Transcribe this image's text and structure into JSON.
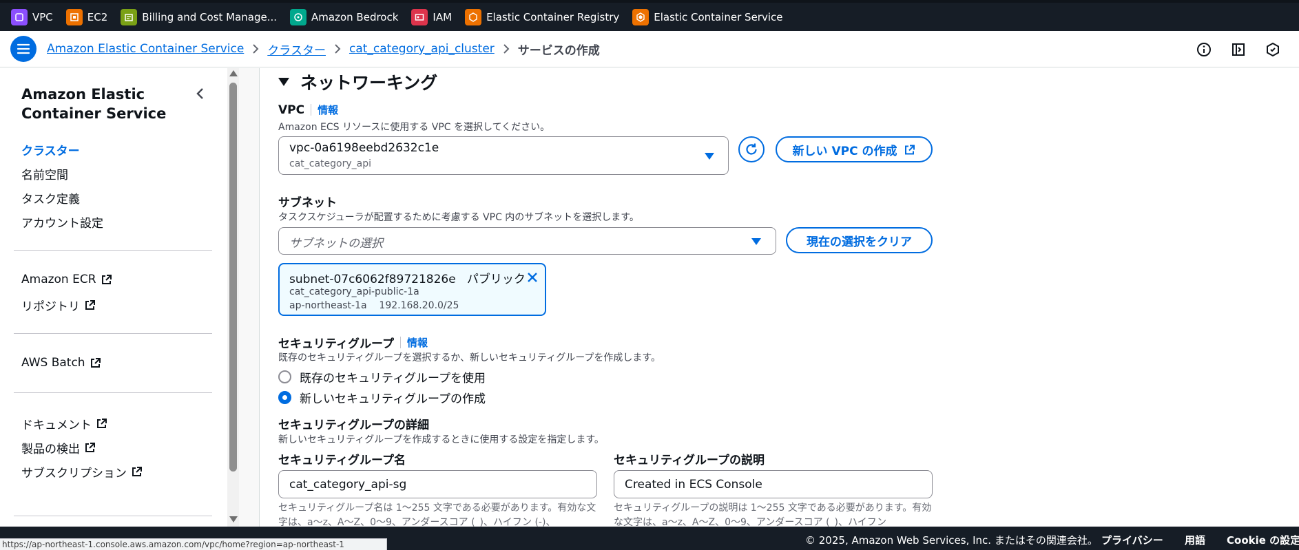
{
  "favorites": [
    {
      "label": "VPC",
      "color": "#8c4fff",
      "icon": "vpc-icon"
    },
    {
      "label": "EC2",
      "color": "#ed7100",
      "icon": "ec2-icon"
    },
    {
      "label": "Billing and Cost Manage...",
      "color": "#7aa116",
      "icon": "billing-icon"
    },
    {
      "label": "Amazon Bedrock",
      "color": "#01a88d",
      "icon": "bedrock-icon"
    },
    {
      "label": "IAM",
      "color": "#dd344c",
      "icon": "iam-icon"
    },
    {
      "label": "Elastic Container Registry",
      "color": "#ed7100",
      "icon": "ecr-icon"
    },
    {
      "label": "Elastic Container Service",
      "color": "#ed7100",
      "icon": "ecs-icon"
    }
  ],
  "breadcrumb": {
    "items": [
      "Amazon Elastic Container Service",
      "クラスター",
      "cat_category_api_cluster"
    ],
    "current": "サービスの作成"
  },
  "sidebar": {
    "title": "Amazon Elastic Container Service",
    "nav": [
      "クラスター",
      "名前空間",
      "タスク定義",
      "アカウント設定"
    ],
    "ecr_link": "Amazon ECR",
    "repo_link": "リポジトリ",
    "batch_link": "AWS Batch",
    "docs_link": "ドキュメント",
    "discover_link": "製品の検出",
    "subscription_link": "サブスクリプション"
  },
  "networking": {
    "title": "ネットワーキング",
    "vpc": {
      "label": "VPC",
      "info": "情報",
      "description": "Amazon ECS リソースに使用する VPC を選択してください。",
      "selected_id": "vpc-0a6198eebd2632c1e",
      "selected_name": "cat_category_api",
      "create_button": "新しい VPC の作成"
    },
    "subnet": {
      "label": "サブネット",
      "description": "タスクスケジューラが配置するために考慮する VPC 内のサブネットを選択します。",
      "placeholder": "サブネットの選択",
      "clear_button": "現在の選択をクリア",
      "token_id": "subnet-07c6062f89721826e",
      "token_type": "パブリック",
      "token_name": "cat_category_api-public-1a",
      "token_az": "ap-northeast-1a",
      "token_cidr": "192.168.20.0/25"
    },
    "security_group": {
      "label": "セキュリティグループ",
      "info": "情報",
      "description": "既存のセキュリティグループを選択するか、新しいセキュリティグループを作成します。",
      "option_existing": "既存のセキュリティグループを使用",
      "option_new": "新しいセキュリティグループの作成",
      "details_title": "セキュリティグループの詳細",
      "details_description": "新しいセキュリティグループを作成するときに使用する設定を指定します。",
      "name_label": "セキュリティグループ名",
      "name_value": "cat_category_api-sg",
      "name_hint": "セキュリティグループ名は 1〜255 文字である必要があります。有効な文字は、a〜z、A〜Z、0〜9、アンダースコア (_)、ハイフン (-)、",
      "desc_label": "セキュリティグループの説明",
      "desc_value": "Created in ECS Console",
      "desc_hint": "セキュリティグループの説明は 1〜255 文字である必要があります。有効な文字は、a〜z、A〜Z、0〜9、アンダースコア (_)、ハイフン"
    }
  },
  "footer": {
    "copyright": "© 2025, Amazon Web Services, Inc. またはその関連会社。",
    "privacy": "プライバシー",
    "terms": "用語",
    "cookie": "Cookie の設定"
  },
  "status_url": "https://ap-northeast-1.console.aws.amazon.com/vpc/home?region=ap-northeast-1"
}
